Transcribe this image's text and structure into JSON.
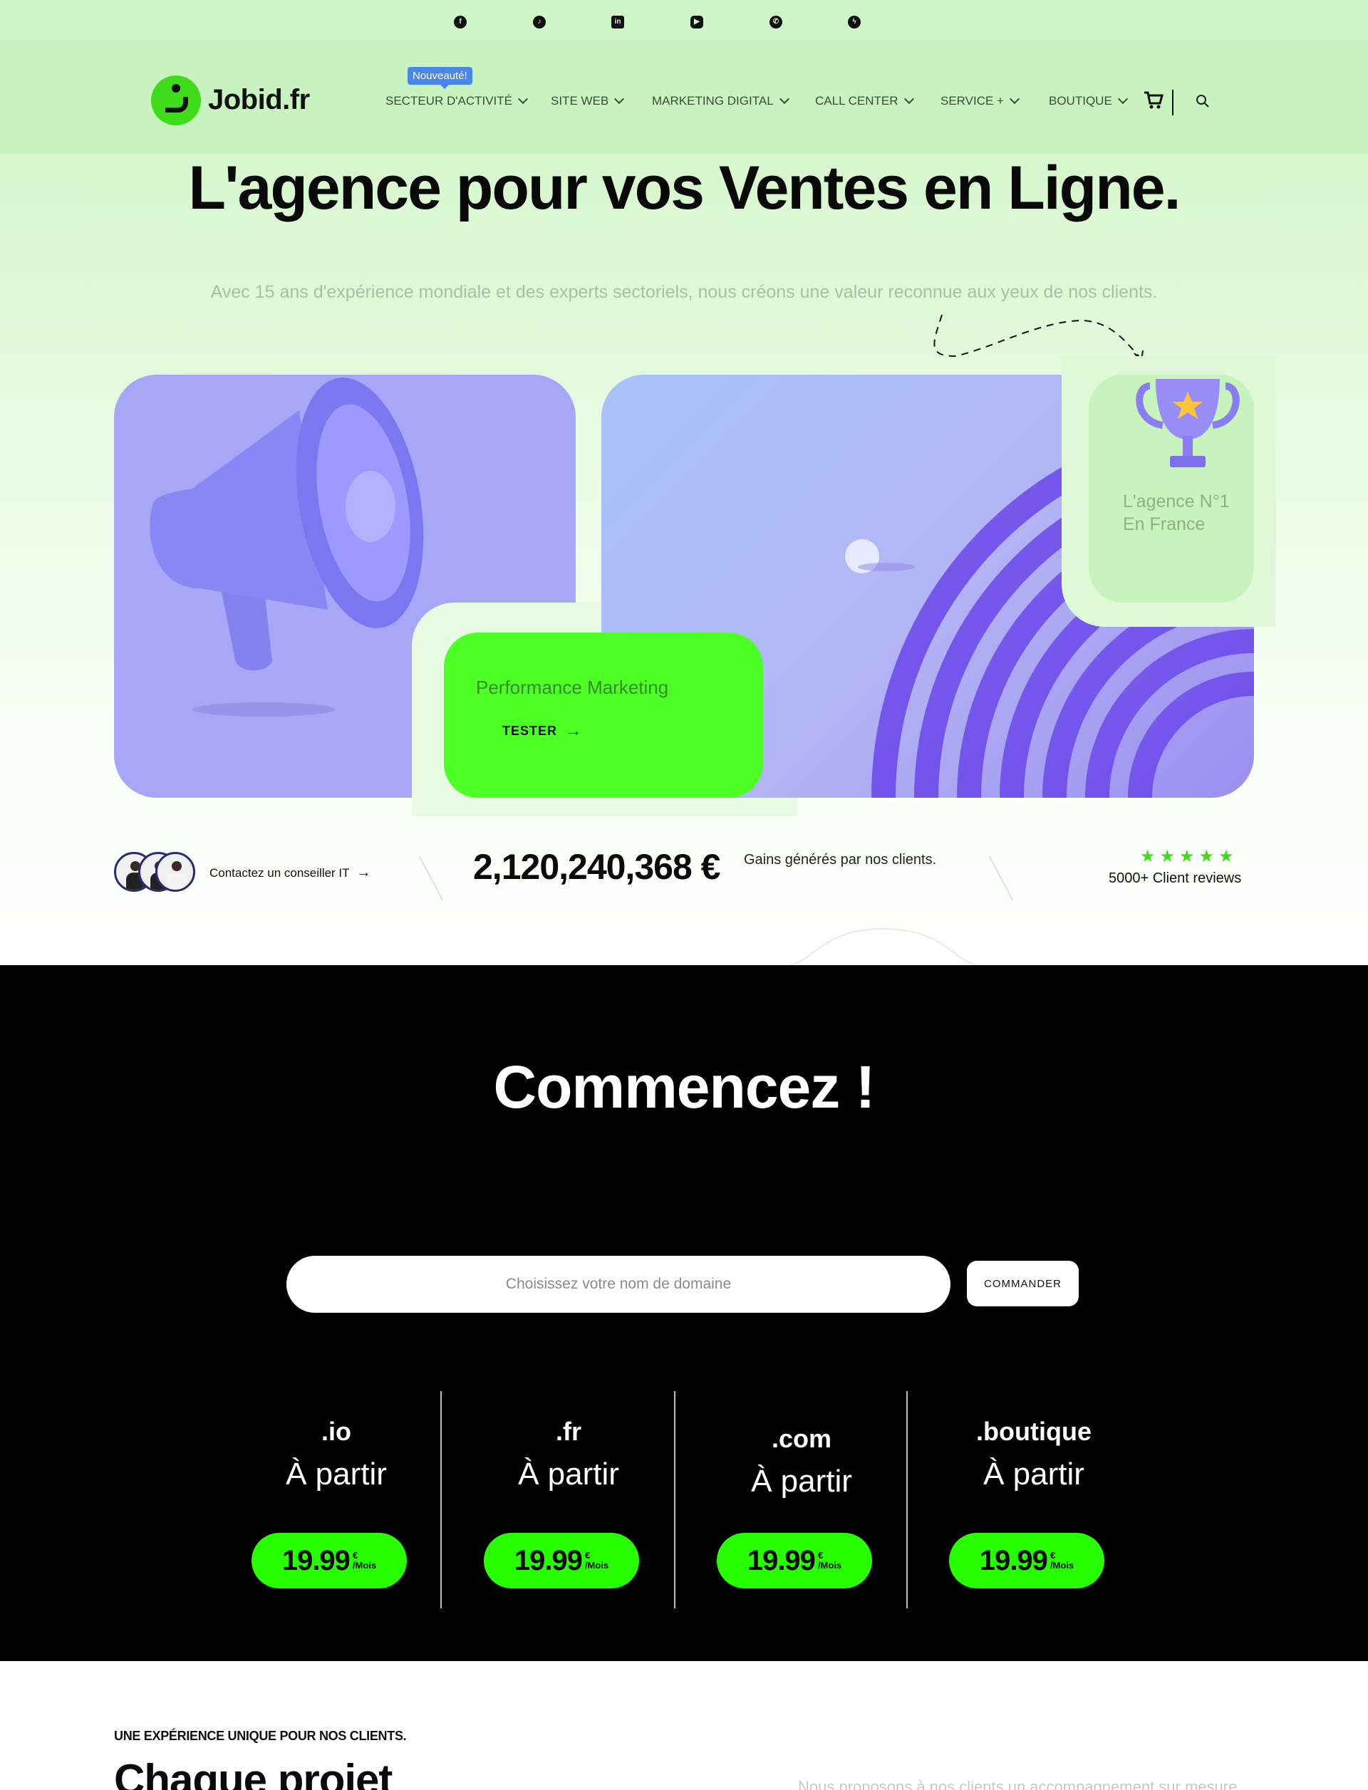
{
  "social": {
    "icons": [
      "facebook-icon",
      "tiktok-icon",
      "linkedin-icon",
      "youtube-icon",
      "whatsapp-icon",
      "messenger-icon"
    ]
  },
  "header": {
    "logo_text": "Jobid.fr",
    "badge": "Nouveauté!",
    "nav": [
      {
        "label": "SECTEUR D'ACTIVITÉ"
      },
      {
        "label": "SITE WEB"
      },
      {
        "label": "MARKETING DIGITAL"
      },
      {
        "label": "CALL CENTER"
      },
      {
        "label": "SERVICE +"
      },
      {
        "label": "BOUTIQUE"
      }
    ]
  },
  "hero": {
    "title": "L'agence pour vos Ventes en Ligne.",
    "subtitle": "Avec 15 ans d'expérience mondiale et des experts sectoriels, nous créons une valeur reconnue aux yeux de nos clients.",
    "performance_label": "Performance Marketing",
    "tester_label": "TESTER",
    "trophy_text": "L'agence N°1 En France"
  },
  "stats": {
    "contact_label": "Contactez un conseiller IT",
    "amount": "2,120,240,368 €",
    "amount_caption": "Gains générés par nos clients.",
    "stars": "★★★★★",
    "reviews": "5000+ Client reviews"
  },
  "domain": {
    "title": "Commencez !",
    "placeholder": "Choisissez votre nom de domaine",
    "button": "COMMANDER",
    "tlds": [
      {
        "name": ".io",
        "from": "À partir",
        "price": "19.99",
        "currency": "€",
        "period": "/Mois"
      },
      {
        "name": ".fr",
        "from": "À partir",
        "price": "19.99",
        "currency": "€",
        "period": "/Mois"
      },
      {
        "name": ".com",
        "from": "À partir",
        "price": "19.99",
        "currency": "€",
        "period": "/Mois"
      },
      {
        "name": ".boutique",
        "from": "À partir",
        "price": "19.99",
        "currency": "€",
        "period": "/Mois"
      }
    ]
  },
  "experience": {
    "kicker": "UNE EXPÉRIENCE UNIQUE POUR NOS CLIENTS.",
    "heading": "Chaque projet",
    "text": "Nous proposons à nos clients un accompagnement sur mesure"
  },
  "colors": {
    "accent_green": "#27ff00",
    "hero_bg": "#cdf5c4",
    "purple": "#a7a6f7",
    "dark": "#000000"
  }
}
